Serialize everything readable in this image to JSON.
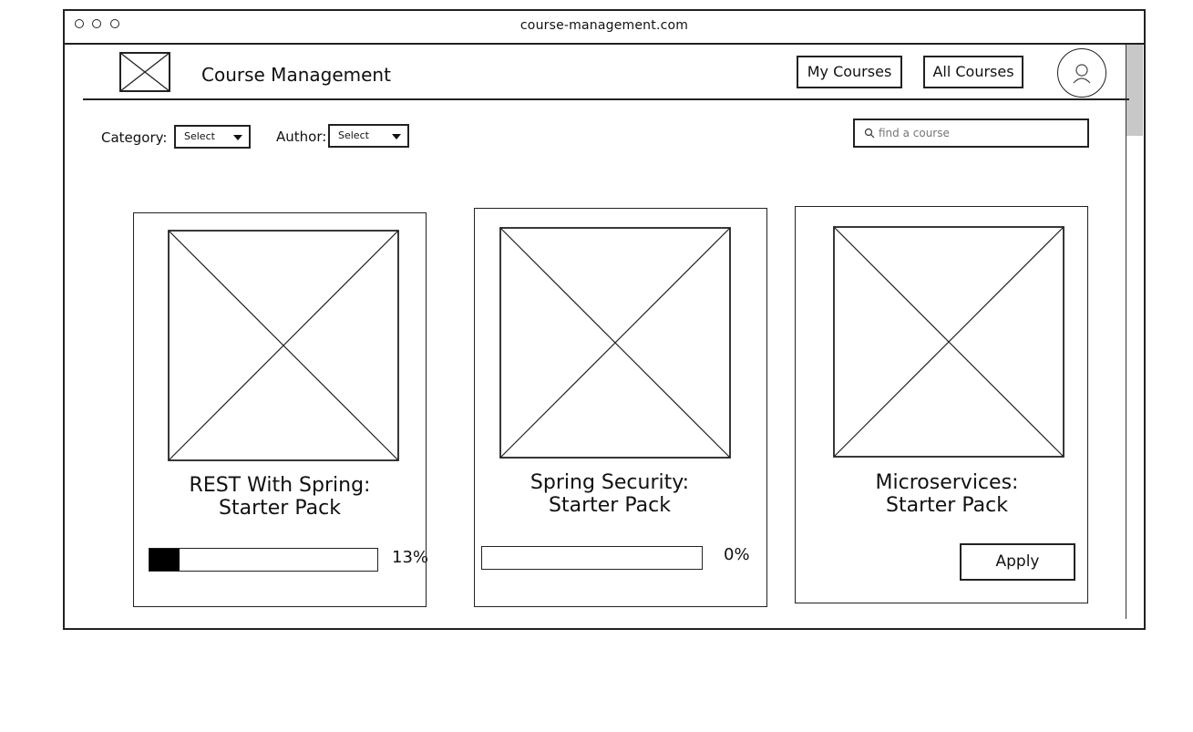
{
  "browser": {
    "url": "course-management.com"
  },
  "header": {
    "app_title": "Course Management",
    "nav": {
      "my_courses": "My Courses",
      "all_courses": "All Courses"
    }
  },
  "filters": {
    "category_label": "Category:",
    "category_value": "Select",
    "author_label": "Author:",
    "author_value": "Select"
  },
  "search": {
    "placeholder": "find a course",
    "value": ""
  },
  "courses": [
    {
      "title_line1": "REST With Spring:",
      "title_line2": "Starter Pack",
      "progress": 0.13,
      "percent_label": "13%"
    },
    {
      "title_line1": "Spring Security:",
      "title_line2": "Starter Pack",
      "progress": 0.0,
      "percent_label": "0%"
    },
    {
      "title_line1": "Microservices:",
      "title_line2": "Starter Pack",
      "action_label": "Apply"
    }
  ]
}
